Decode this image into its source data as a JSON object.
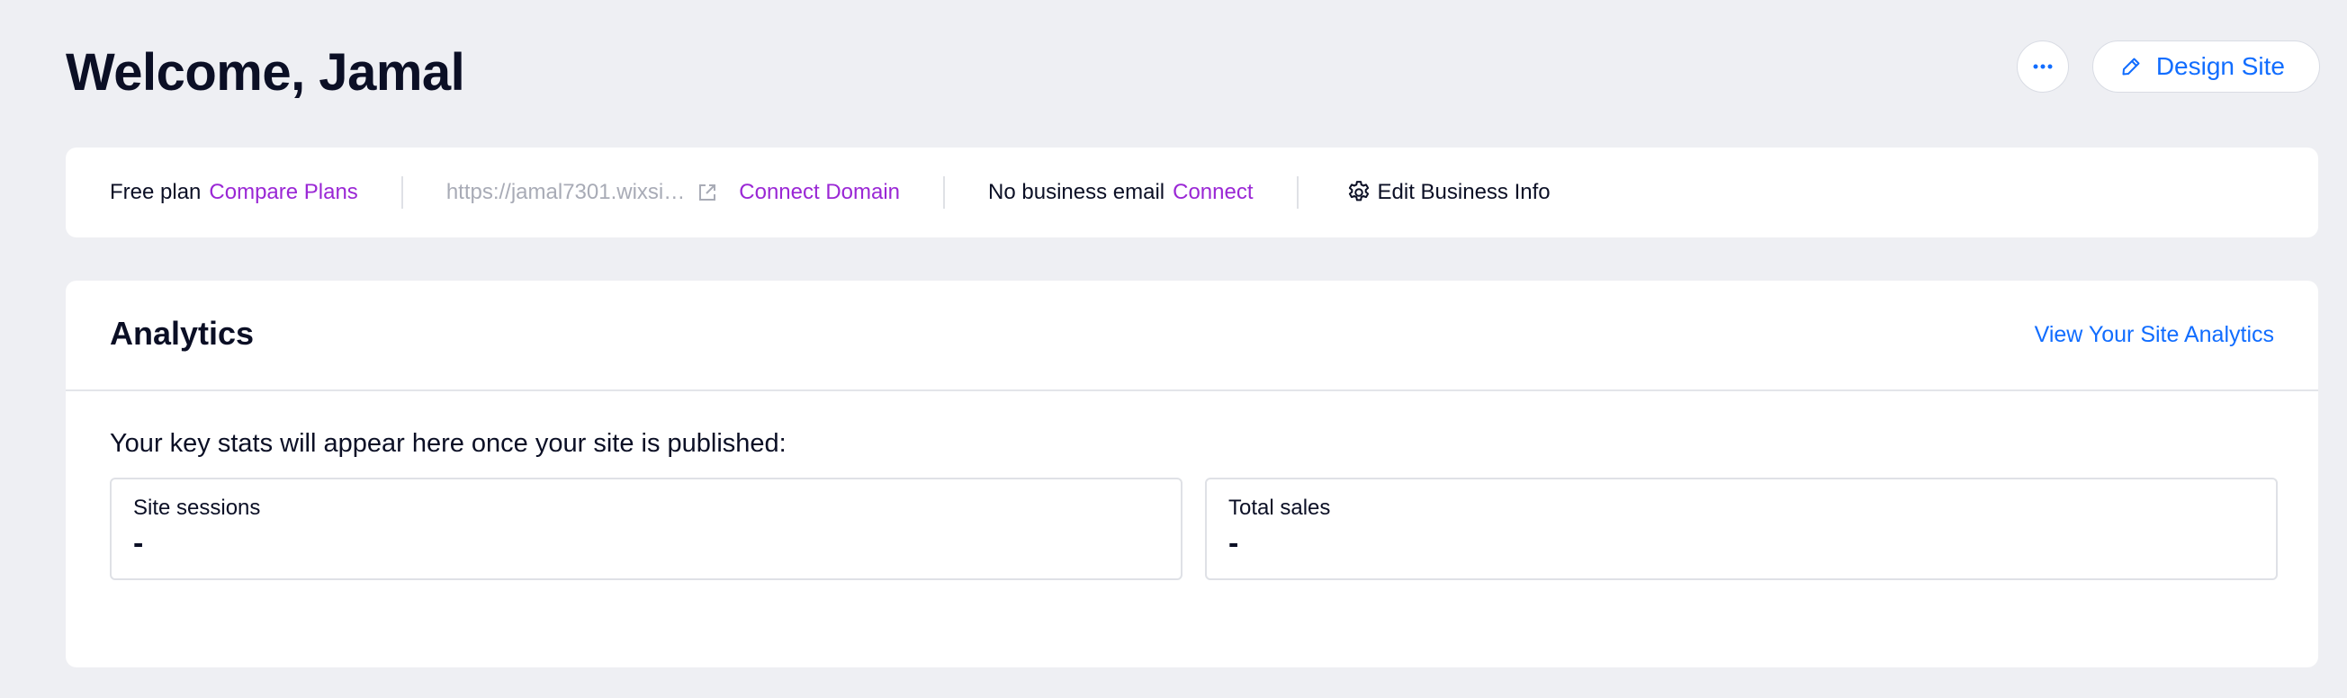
{
  "header": {
    "title": "Welcome, Jamal",
    "more_icon": "ellipsis-icon",
    "design_icon": "pencil-icon",
    "design_label": "Design Site"
  },
  "info_bar": {
    "plan_label": "Free plan",
    "compare_plans": "Compare Plans",
    "site_url": "https://jamal7301.wixsi…",
    "external_link_icon": "external-link-icon",
    "connect_domain": "Connect Domain",
    "email_label": "No business email",
    "connect_email": "Connect",
    "settings_icon": "gear-icon",
    "edit_business_info": "Edit Business Info"
  },
  "analytics": {
    "title": "Analytics",
    "view_link": "View Your Site Analytics",
    "message": "Your key stats will appear here once your site is published:",
    "stats": [
      {
        "label": "Site sessions",
        "value": "-"
      },
      {
        "label": "Total sales",
        "value": "-"
      }
    ]
  },
  "colors": {
    "background": "#eeeff3",
    "accent_blue": "#116dff",
    "accent_purple": "#9a27d5",
    "text_dark": "#0b0f25",
    "text_muted": "#a8abb6"
  }
}
